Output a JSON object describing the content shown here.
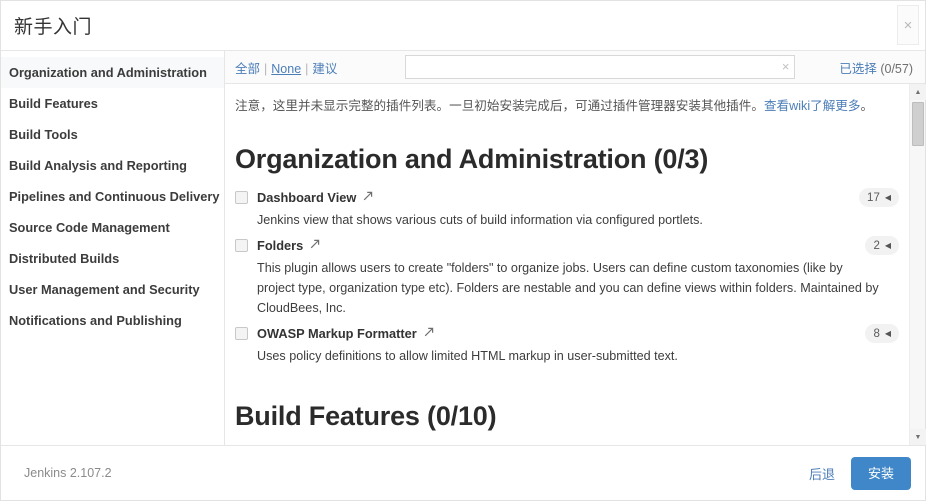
{
  "header": {
    "title": "新手入门",
    "close_label": "×"
  },
  "sidebar": {
    "items": [
      {
        "label": "Organization and Administration",
        "active": true
      },
      {
        "label": "Build Features",
        "active": false
      },
      {
        "label": "Build Tools",
        "active": false
      },
      {
        "label": "Build Analysis and Reporting",
        "active": false
      },
      {
        "label": "Pipelines and Continuous Delivery",
        "active": false
      },
      {
        "label": "Source Code Management",
        "active": false
      },
      {
        "label": "Distributed Builds",
        "active": false
      },
      {
        "label": "User Management and Security",
        "active": false
      },
      {
        "label": "Notifications and Publishing",
        "active": false
      }
    ]
  },
  "toolbar": {
    "select_all_label": "全部",
    "select_none_label": "None",
    "select_suggested_label": "建议",
    "separator": "|",
    "search_value": "",
    "search_placeholder": "",
    "search_clear_label": "×",
    "selected_link_label": "已选择",
    "selected_count": "(0/57)"
  },
  "notice": {
    "text_before_link": "注意，这里并未显示完整的插件列表。一旦初始安装完成后，可通过插件管理器安装其他插件。",
    "link_text": "查看wiki了解更多",
    "text_after_link": "。"
  },
  "sections": [
    {
      "title": "Organization and Administration (0/3)",
      "clipped": false,
      "plugins": [
        {
          "name": "Dashboard View",
          "link_icon": "external-link-icon",
          "badge": "17",
          "badge_arrow": "◀",
          "checked": false,
          "description": "Jenkins view that shows various cuts of build information via configured portlets."
        },
        {
          "name": "Folders",
          "link_icon": "external-link-icon",
          "badge": "2",
          "badge_arrow": "◀",
          "checked": false,
          "description": "This plugin allows users to create \"folders\" to organize jobs. Users can define custom taxonomies (like by project type, organization type etc). Folders are nestable and you can define views within folders. Maintained by CloudBees, Inc."
        },
        {
          "name": "OWASP Markup Formatter",
          "link_icon": "external-link-icon",
          "badge": "8",
          "badge_arrow": "◀",
          "checked": false,
          "description": "Uses policy definitions to allow limited HTML markup in user-submitted text."
        }
      ]
    },
    {
      "title": "Build Features (0/10)",
      "clipped": true,
      "plugins": []
    }
  ],
  "scrollbar": {
    "up_arrow": "▲",
    "down_arrow": "▼"
  },
  "footer": {
    "version": "Jenkins 2.107.2",
    "back_label": "后退",
    "install_label": "安装"
  },
  "colors": {
    "accent_blue": "#4c7eb8",
    "button_blue": "#3f87c8",
    "text": "#333333",
    "border": "#e6e6e6"
  }
}
